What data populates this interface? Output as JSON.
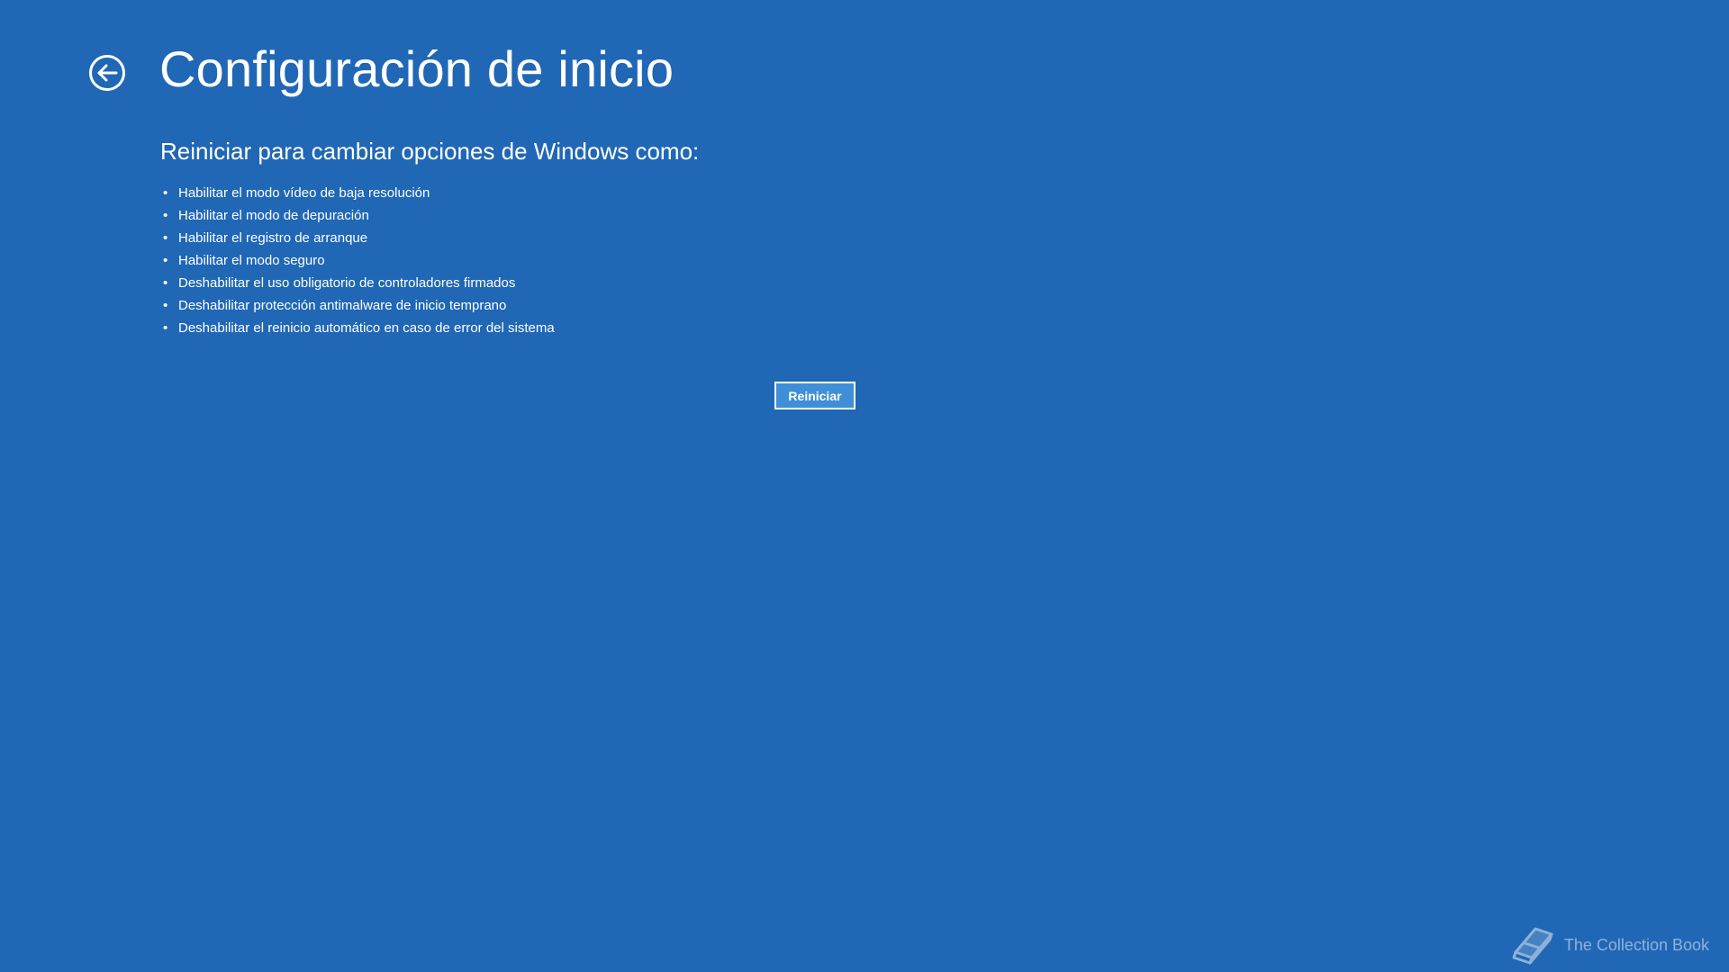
{
  "header": {
    "back_icon": "back-arrow-circle-icon",
    "title": "Configuración de inicio"
  },
  "main": {
    "subtitle": "Reiniciar para cambiar opciones de Windows como:",
    "bullet": "•",
    "options": [
      "Habilitar el modo vídeo de baja resolución",
      "Habilitar el modo de depuración",
      "Habilitar el registro de arranque",
      "Habilitar el modo seguro",
      "Deshabilitar el uso obligatorio de controladores firmados",
      "Deshabilitar protección antimalware de inicio temprano",
      "Deshabilitar el reinicio automático en caso de error del sistema"
    ],
    "restart_label": "Reiniciar"
  },
  "watermark": {
    "icon": "book-icon",
    "text": "The Collection Book"
  },
  "colors": {
    "background": "#2067b6",
    "button_fill": "#3f8fd8",
    "text": "#ffffff"
  }
}
